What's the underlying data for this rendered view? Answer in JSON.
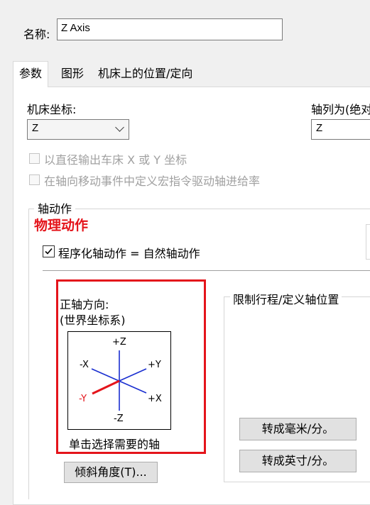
{
  "name_label": "名称:",
  "name_value": "Z Axis",
  "tabs": [
    {
      "label": "参数",
      "active": true
    },
    {
      "label": "图形",
      "active": false
    },
    {
      "label": "机床上的位置/定向",
      "active": false
    }
  ],
  "machine_coord": {
    "label": "机床坐标:",
    "value": "Z"
  },
  "axis_column": {
    "label": "轴列为(绝对",
    "value": "Z"
  },
  "checkboxes": [
    {
      "label": "以直径输出车床 X 或 Y 坐标",
      "checked": false,
      "disabled": true
    },
    {
      "label": "在轴向移动事件中定义宏指令驱动轴进给率",
      "checked": false,
      "disabled": true
    }
  ],
  "axis_action": {
    "group_title": "轴动作",
    "physical_label": "物理动作",
    "physical_color": "#e4141b",
    "programmed_label": "程序化轴动作 = 自然轴动作",
    "programmed_checked": true
  },
  "direction": {
    "title_line1": "正轴方向:",
    "title_line2": "(世界坐标系)",
    "axes": {
      "pz": "+Z",
      "nz": "-Z",
      "nx": "-X",
      "py": "+Y",
      "ny": "-Y",
      "px": "+X"
    },
    "selected_axis": "-Y",
    "hint": "单击选择需要的轴",
    "highlight_color": "#e4141b"
  },
  "limits": {
    "group_title": "限制行程/定义轴位置",
    "mm_button": "转成毫米/分。",
    "inch_button": "转成英寸/分。"
  },
  "tilt_button": "倾斜角度(T)..."
}
